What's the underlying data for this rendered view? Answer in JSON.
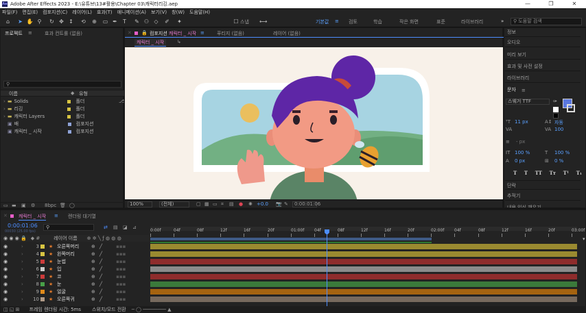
{
  "window": {
    "title": "Adobe After Effects 2023 - E:\\유튜브\\13#활용\\Chapter 03\\캐릭터리깅.aep",
    "app_icon": "Ae"
  },
  "menu": [
    "파일(F)",
    "편집(E)",
    "컴포지션(C)",
    "레이어(L)",
    "효과(T)",
    "애니메이션(A)",
    "보기(V)",
    "창(W)",
    "도움말(H)"
  ],
  "toolbar": {
    "snap_label": "스냅",
    "search_placeholder": "도움말 검색",
    "workspaces": [
      "기본값",
      "검토",
      "학습",
      "작은 화면",
      "표준",
      "라이브러리"
    ],
    "active_workspace": "기본값"
  },
  "project": {
    "tabs": [
      "프로젝트",
      "효과 컨트롤 (없음)"
    ],
    "search_placeholder": "",
    "col_name": "이름",
    "col_type": "유형",
    "items": [
      {
        "name": "Solids",
        "type": "폴더",
        "color": "#d7c442"
      },
      {
        "name": "리깅",
        "type": "폴더",
        "color": "#d7c442"
      },
      {
        "name": "캐릭터 Layers",
        "type": "폴더",
        "color": "#d7c442"
      },
      {
        "name": "배",
        "type": "컴포지션",
        "color": "#8fa3d8"
      },
      {
        "name": "캐릭터 _ 시작",
        "type": "컴포지션",
        "color": "#8fa3d8"
      }
    ],
    "bpc": "8bpc"
  },
  "composition": {
    "tabs": [
      "컴포지션",
      "캐릭터 _ 시작",
      "푸티지 (없음)",
      "레이어 (없음)"
    ],
    "breadcrumb": "캐릭터 _ 시작",
    "zoom": "100%",
    "resolution": "(전체)",
    "exposure": "+0.0",
    "timecode": "0:00:01:06"
  },
  "right_panel": {
    "items": [
      "정보",
      "오디오",
      "미리 보기",
      "효과 및 사전 설정",
      "라이브러리",
      "문자",
      "단락",
      "추적기",
      "내용 인식 채우기"
    ],
    "font": "스웨거 TTF",
    "font_size": "11 px",
    "tracking": "자동",
    "leading": "100",
    "px1": "- px",
    "scale_v": "100 %",
    "scale_h": "100 %",
    "baseline": "0 px",
    "tsume": "0 %",
    "type_buttons": [
      "T",
      "T",
      "TT",
      "Tт",
      "T¹",
      "T₁"
    ]
  },
  "timeline": {
    "tabs": [
      "캐릭터 _ 시작",
      "렌더링 대기열"
    ],
    "timecode": "0:00:01:06",
    "frames": "00030 (25.00 fps)",
    "search_placeholder": "",
    "layer_col": "레이어 이름",
    "switch_col": "스위치/모드",
    "render_time": "프레임 렌더링 시간: 5ms",
    "footer_mode": "스위치/모드 전환",
    "ruler": [
      "0:00f",
      "04f",
      "08f",
      "12f",
      "16f",
      "20f",
      "01:00f",
      "04f",
      "08f",
      "12f",
      "16f",
      "20f",
      "02:00f",
      "04f",
      "08f",
      "12f",
      "16f",
      "20f",
      "03:00f"
    ],
    "layers": [
      {
        "num": "3",
        "name": "오른쪽머리",
        "color": "#d7c442",
        "bar": "#9a8a30"
      },
      {
        "num": "4",
        "name": "왼쪽머리",
        "color": "#d7c442",
        "bar": "#9a8a30"
      },
      {
        "num": "5",
        "name": "눈썹",
        "color": "#cc3b3b",
        "bar": "#8e2c2c"
      },
      {
        "num": "6",
        "name": "입",
        "color": "#cccccc",
        "bar": "#8b8b8b"
      },
      {
        "num": "7",
        "name": "코",
        "color": "#cc3b3b",
        "bar": "#8e2c2c"
      },
      {
        "num": "8",
        "name": "눈",
        "color": "#48a048",
        "bar": "#3b7a3b"
      },
      {
        "num": "9",
        "name": "얼굴",
        "color": "#e08a1a",
        "bar": "#a56310"
      },
      {
        "num": "10",
        "name": "오른쪽귀",
        "color": "#b09a86",
        "bar": "#776a5e"
      }
    ]
  },
  "colors": {
    "accent": "#4d8dff",
    "bg": "#161616",
    "panel": "#232323",
    "timecode": "#4d8dff",
    "fill_swatch": "#5b78e0"
  }
}
